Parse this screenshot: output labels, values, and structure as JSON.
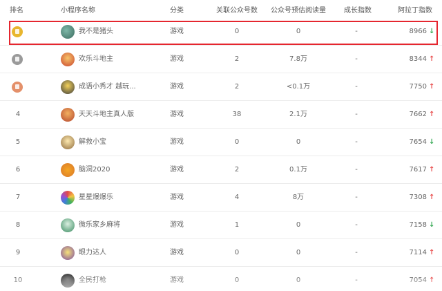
{
  "header": {
    "rank": "排名",
    "name": "小程序名称",
    "category": "分类",
    "linked": "关联公众号数",
    "reads": "公众号预估阅读量",
    "growth": "成长指数",
    "index": "阿拉丁指数"
  },
  "colors": {
    "gold_medal": "#e8b62e",
    "silver_medal": "#9a9a9a",
    "bronze_medal": "#e4906a",
    "index_blue": "#2f66c9",
    "trend_up": "#e84a4a",
    "trend_down": "#33a852",
    "highlight_border": "#e5262f"
  },
  "rows": [
    {
      "rank": "1",
      "medal": "gold",
      "name": "我不是猪头",
      "category": "游戏",
      "linked": "0",
      "reads": "0",
      "growth": "-",
      "index": "8966",
      "trend": "down",
      "trend_icon": "↓"
    },
    {
      "rank": "2",
      "medal": "silver",
      "name": "欢乐斗地主",
      "category": "游戏",
      "linked": "2",
      "reads": "7.8万",
      "growth": "-",
      "index": "8344",
      "trend": "up",
      "trend_icon": "↑"
    },
    {
      "rank": "3",
      "medal": "bronze",
      "name": "成语小秀才 越玩...",
      "category": "游戏",
      "linked": "2",
      "reads": "<0.1万",
      "growth": "-",
      "index": "7750",
      "trend": "up",
      "trend_icon": "↑"
    },
    {
      "rank": "4",
      "medal": "",
      "name": "天天斗地主真人版",
      "category": "游戏",
      "linked": "38",
      "reads": "2.1万",
      "growth": "-",
      "index": "7662",
      "trend": "up",
      "trend_icon": "↑"
    },
    {
      "rank": "5",
      "medal": "",
      "name": "解救小宝",
      "category": "游戏",
      "linked": "0",
      "reads": "0",
      "growth": "-",
      "index": "7654",
      "trend": "down",
      "trend_icon": "↓"
    },
    {
      "rank": "6",
      "medal": "",
      "name": "脑洞2020",
      "category": "游戏",
      "linked": "2",
      "reads": "0.1万",
      "growth": "-",
      "index": "7617",
      "trend": "up",
      "trend_icon": "↑"
    },
    {
      "rank": "7",
      "medal": "",
      "name": "星星爆爆乐",
      "category": "游戏",
      "linked": "4",
      "reads": "8万",
      "growth": "-",
      "index": "7308",
      "trend": "up",
      "trend_icon": "↑"
    },
    {
      "rank": "8",
      "medal": "",
      "name": "微乐家乡麻将",
      "category": "游戏",
      "linked": "1",
      "reads": "0",
      "growth": "-",
      "index": "7158",
      "trend": "down",
      "trend_icon": "↓"
    },
    {
      "rank": "9",
      "medal": "",
      "name": "眼力达人",
      "category": "游戏",
      "linked": "0",
      "reads": "0",
      "growth": "-",
      "index": "7114",
      "trend": "up",
      "trend_icon": "↑"
    },
    {
      "rank": "10",
      "medal": "",
      "name": "全民打枪",
      "category": "游戏",
      "linked": "0",
      "reads": "0",
      "growth": "-",
      "index": "7054",
      "trend": "up",
      "trend_icon": "↑"
    }
  ]
}
